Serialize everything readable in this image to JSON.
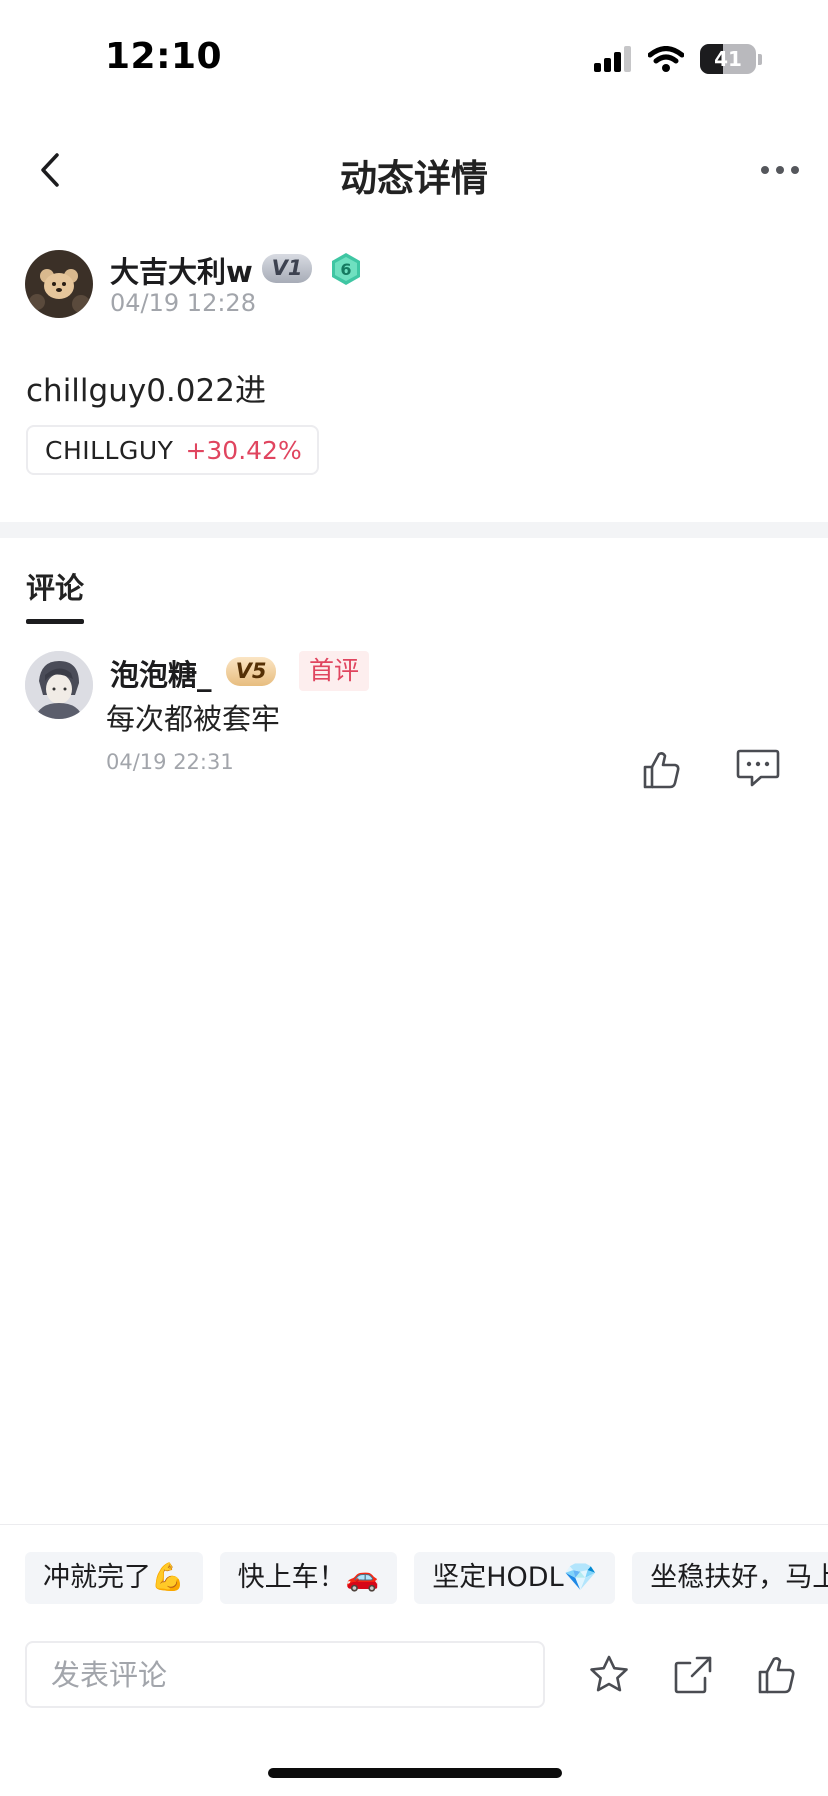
{
  "status_bar": {
    "time": "12:10",
    "battery_level": 41,
    "battery_label": "41",
    "icons": [
      "cellular-signal-icon",
      "wifi-icon",
      "battery-icon"
    ]
  },
  "nav": {
    "title": "动态详情",
    "back_icon": "chevron-left-icon",
    "more_icon": "more-horizontal-icon"
  },
  "post": {
    "author": {
      "name": "大吉大利w",
      "vip_level": "V1",
      "level": "6"
    },
    "time": "04/19 12:28",
    "content": "chillguy0.022进",
    "coin_tag": {
      "symbol": "CHILLGUY",
      "change": "+30.42%"
    }
  },
  "comments_section": {
    "tab_label": "评论",
    "comments": [
      {
        "author": "泡泡糖_",
        "vip_level": "V5",
        "badge": "首评",
        "content": "每次都被套牢",
        "time": "04/19 22:31"
      }
    ]
  },
  "bottom": {
    "quick_replies": [
      {
        "text": "冲就完了💪"
      },
      {
        "text": "快上车！🚗"
      },
      {
        "text": "坚定HODL💎"
      },
      {
        "text": "坐稳扶好，马上起飞"
      }
    ],
    "input_placeholder": "发表评论",
    "actions": [
      "star-icon",
      "share-icon",
      "thumbs-up-icon"
    ]
  },
  "colors": {
    "accent_up": "#e0455f",
    "level_badge": "#3fc6a3",
    "vip_gold": "#e7bd7f",
    "vip_grey": "#a7acb7"
  }
}
